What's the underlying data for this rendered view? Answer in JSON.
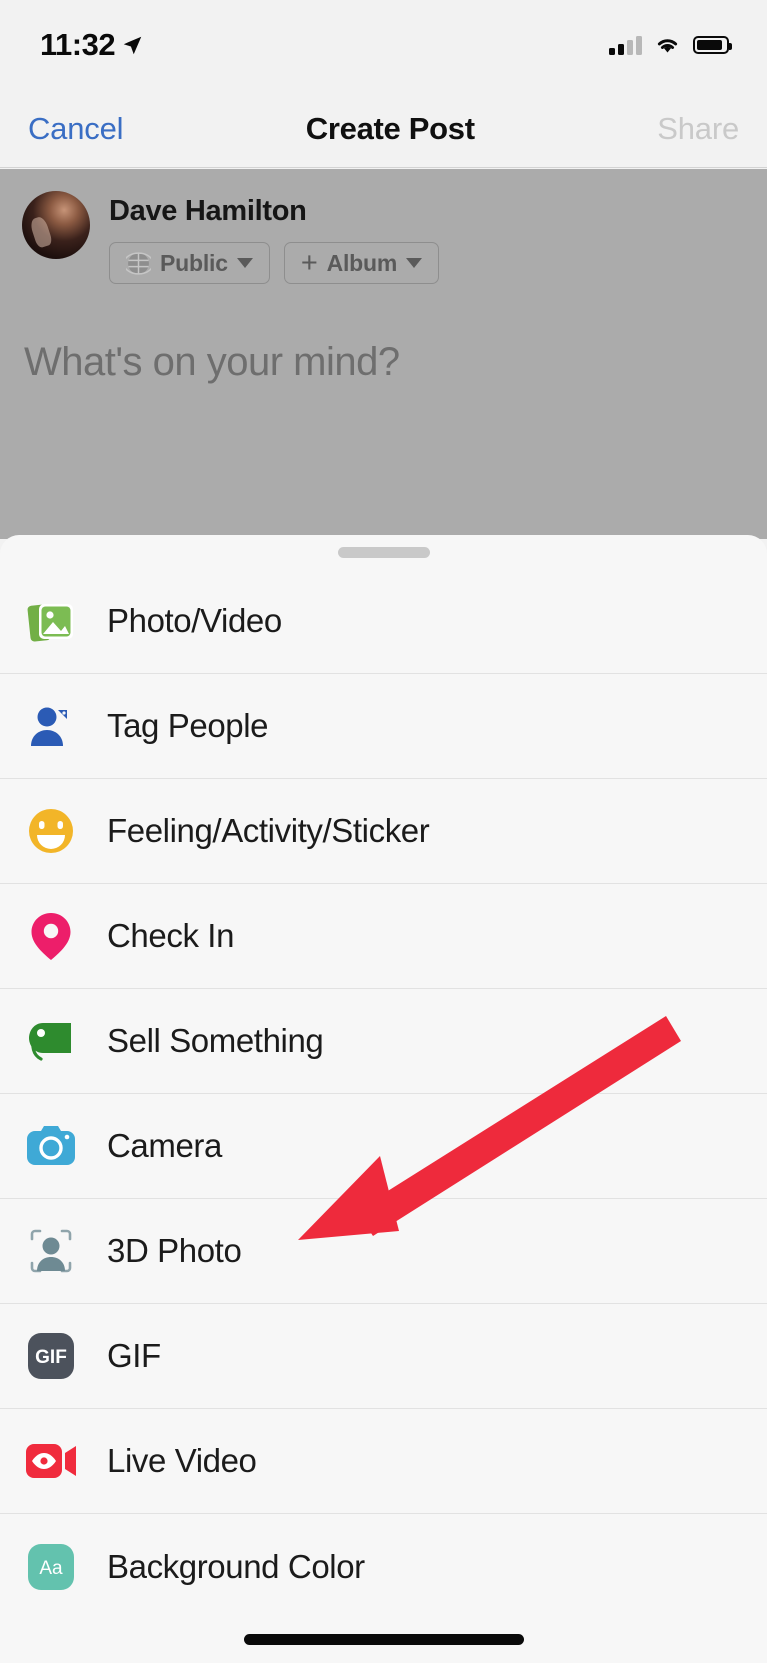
{
  "status_bar": {
    "time": "11:32",
    "location_icon": "location-arrow-icon",
    "cellular_icon": "cellular-signal-icon",
    "cellular_bars_filled": 2,
    "cellular_bars_total": 4,
    "wifi_icon": "wifi-icon",
    "battery_icon": "battery-icon",
    "battery_level_percent": 88
  },
  "nav_bar": {
    "cancel_label": "Cancel",
    "title": "Create Post",
    "share_label": "Share",
    "cancel_color": "#3A6EC4",
    "share_color": "#C9C9C9"
  },
  "composer": {
    "user_name": "Dave Hamilton",
    "avatar_icon": "avatar",
    "privacy": {
      "label": "Public",
      "icon": "globe-icon",
      "chevron": "chevron-down-icon"
    },
    "album": {
      "label": "Album",
      "icon": "plus-icon",
      "chevron": "chevron-down-icon"
    },
    "placeholder": "What's on your mind?"
  },
  "sheet": {
    "grabber": "drag-handle",
    "items": [
      {
        "label": "Photo/Video",
        "icon": "photo-video-icon",
        "color": "#73B24B"
      },
      {
        "label": "Tag People",
        "icon": "tag-people-icon",
        "color": "#2B5BB5"
      },
      {
        "label": "Feeling/Activity/Sticker",
        "icon": "smiley-face-icon",
        "color": "#F2B528"
      },
      {
        "label": "Check In",
        "icon": "map-pin-icon",
        "color": "#ED1E6A"
      },
      {
        "label": "Sell Something",
        "icon": "price-tag-icon",
        "color": "#2E8B2E"
      },
      {
        "label": "Camera",
        "icon": "camera-icon",
        "color": "#3FA9D6"
      },
      {
        "label": "3D Photo",
        "icon": "three-d-photo-icon",
        "color": "#6E8A93"
      },
      {
        "label": "GIF",
        "icon": "gif-icon",
        "color": "#4C525C"
      },
      {
        "label": "Live Video",
        "icon": "live-video-icon",
        "color": "#F02B3D"
      },
      {
        "label": "Background Color",
        "icon": "background-color-icon",
        "color": "#63C2AE"
      }
    ]
  },
  "annotation": {
    "arrow_icon": "red-arrow-annotation",
    "color": "#EE2A3C",
    "points_at": "3D Photo"
  },
  "home_indicator": "home-indicator"
}
